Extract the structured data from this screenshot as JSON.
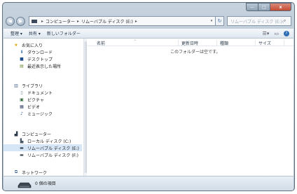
{
  "window": {
    "caption_buttons": {
      "minimize": "—",
      "maximize": "□",
      "close": "x"
    }
  },
  "address": {
    "crumbs": [
      "コンピューター",
      "リムーバブル ディスク (E:)"
    ],
    "search_placeholder": "リムーバブル ディスク (E:)の検索"
  },
  "toolbar": {
    "organize": "整理 ▾",
    "share": "共有 ▾",
    "new_folder": "新しいフォルダー"
  },
  "nav": {
    "favorites": {
      "label": "お気に入り",
      "items": [
        "ダウンロード",
        "デスクトップ",
        "最近表示した場所"
      ]
    },
    "libraries": {
      "label": "ライブラリ",
      "items": [
        "ドキュメント",
        "ピクチャ",
        "ビデオ",
        "ミュージック"
      ]
    },
    "computer": {
      "label": "コンピューター",
      "items": [
        "ローカル ディスク (C:)",
        "リムーバブル ディスク (E:)",
        "リムーバブル ディスク (F:)"
      ]
    },
    "network": {
      "label": "ネットワーク"
    }
  },
  "main": {
    "columns": [
      "名前",
      "更新日時",
      "種類",
      "サイズ"
    ],
    "empty_message": "このフォルダーは空です。"
  },
  "details": {
    "item_count": "0 個の項目"
  },
  "colors": {
    "selection": "#d7e6f6",
    "frame": "#aebdcb",
    "link": "#1e3145"
  },
  "icons": [
    "back-icon",
    "forward-icon",
    "refresh-icon",
    "search-icon",
    "help-icon",
    "star-icon",
    "folder-icon",
    "drive-icon",
    "network-icon"
  ]
}
